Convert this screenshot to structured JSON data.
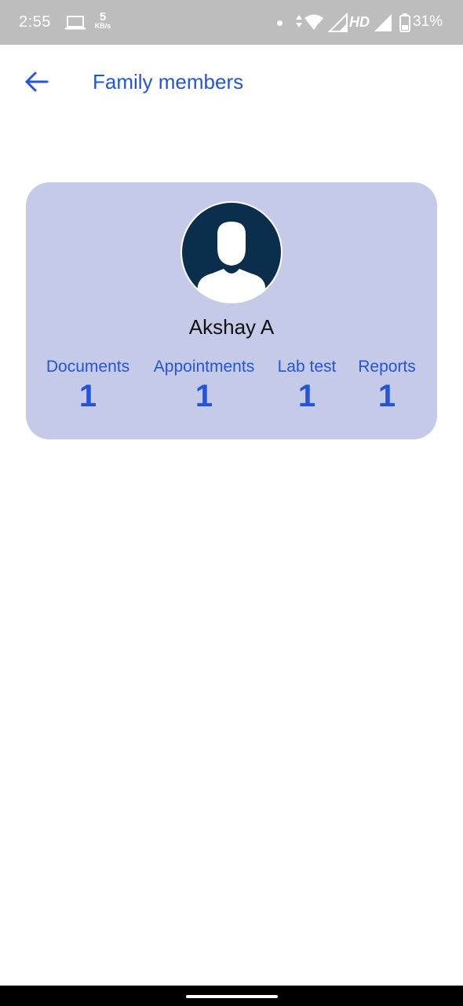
{
  "status_bar": {
    "time": "2:55",
    "network_speed_value": "5",
    "network_speed_unit": "KB/s",
    "network_type": "HD",
    "battery_percent": "31%",
    "icons": [
      "laptop-icon",
      "notification-dot-icon",
      "data-arrows-icon",
      "wifi-icon",
      "signal-icon",
      "signal-icon",
      "battery-icon"
    ]
  },
  "app_bar": {
    "back_icon": "arrow-left-icon",
    "title": "Family members"
  },
  "member": {
    "avatar_icon": "user-avatar-icon",
    "name": "Akshay A",
    "stats": [
      {
        "label": "Documents",
        "value": "1"
      },
      {
        "label": "Appointments",
        "value": "1"
      },
      {
        "label": "Lab test",
        "value": "1"
      },
      {
        "label": "Reports",
        "value": "1"
      }
    ]
  },
  "colors": {
    "accent": "#2355d6",
    "card_background": "#c5cae9",
    "avatar_dark": "#0b2e4d",
    "status_bar": "#bdbdbd"
  }
}
